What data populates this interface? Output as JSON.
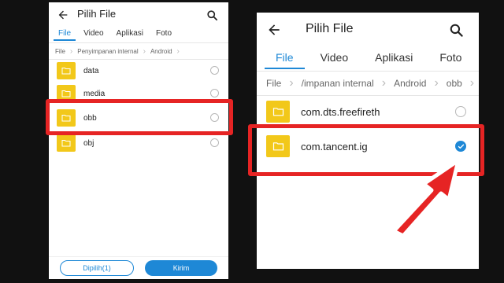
{
  "left": {
    "title": "Pilih File",
    "tabs": [
      "File",
      "Video",
      "Aplikasi",
      "Foto"
    ],
    "breadcrumb": [
      "File",
      "Penyimpanan internal",
      "Android"
    ],
    "items": [
      "data",
      "media",
      "obb",
      "obj"
    ],
    "buttons": {
      "selected": "Dipilih(1)",
      "send": "Kirim"
    }
  },
  "right": {
    "title": "Pilih File",
    "tabs": [
      "File",
      "Video",
      "Aplikasi",
      "Foto"
    ],
    "breadcrumb": [
      "File",
      "/impanan internal",
      "Android",
      "obb"
    ],
    "items": [
      "com.dts.freefireth",
      "com.tancent.ig"
    ],
    "selected_item": "com.tancent.ig"
  },
  "colors": {
    "accent": "#1e88d6",
    "folder": "#f2c81a",
    "highlight": "#e62424",
    "background": "#111111"
  },
  "icons": [
    "back-arrow-icon",
    "search-icon",
    "folder-icon",
    "radio-unchecked-icon",
    "radio-checked-icon",
    "red-pointer-arrow-icon"
  ]
}
